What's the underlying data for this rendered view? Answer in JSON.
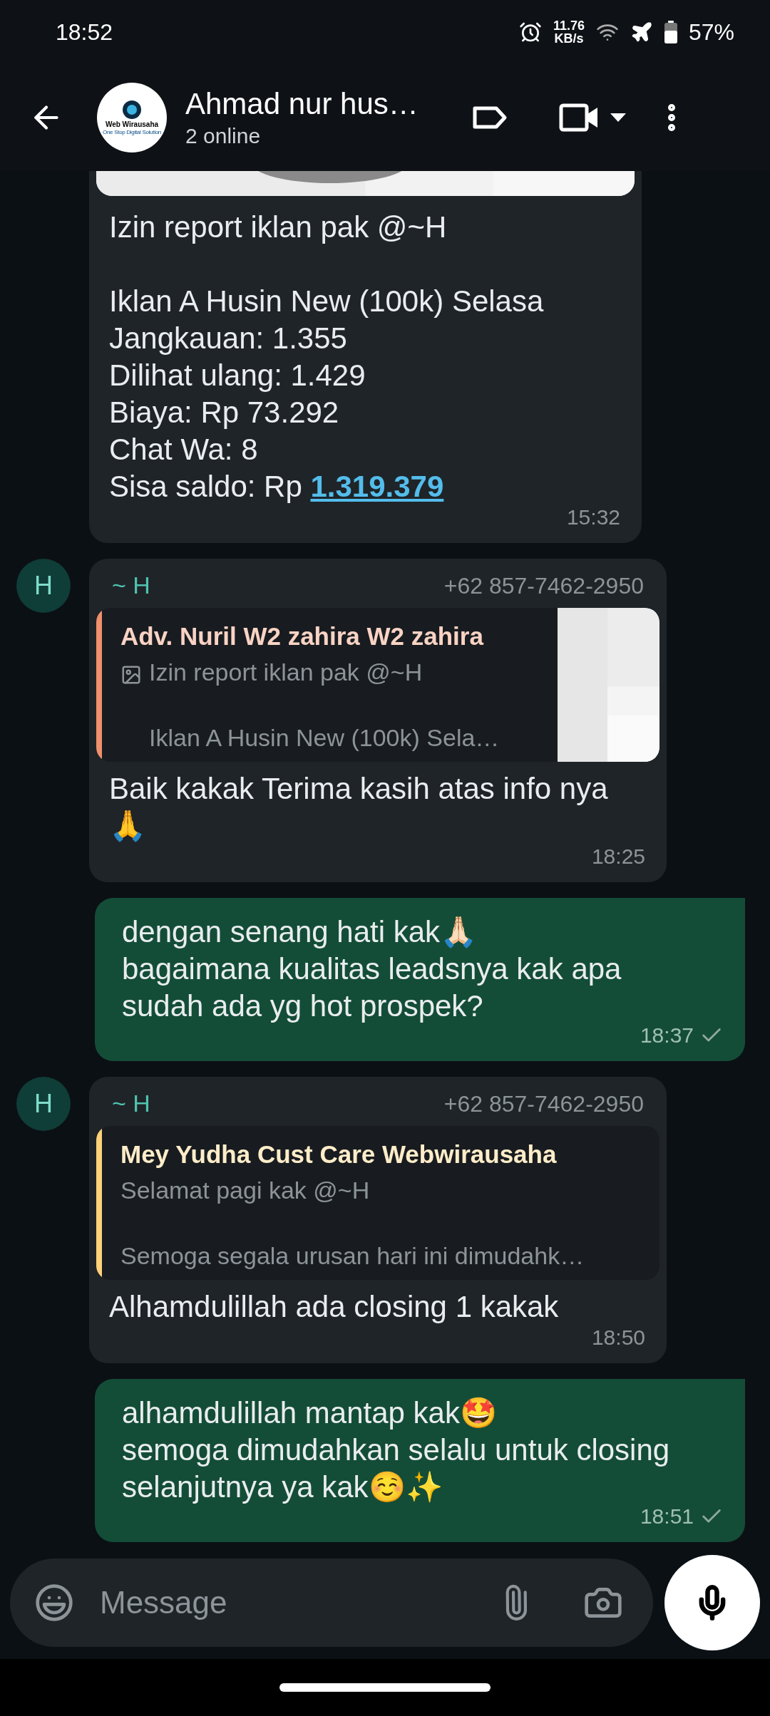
{
  "status_bar": {
    "time": "18:52",
    "net_speed": "11.76",
    "net_unit": "KB/s",
    "battery": "57%"
  },
  "header": {
    "avatar_title": "Web Wirausaha",
    "avatar_tagline": "One Stop Digital Solution",
    "title": "Ahmad nur hus…",
    "subtitle": "2 online"
  },
  "messages": [
    {
      "kind": "incoming",
      "has_picture": true,
      "body": "Izin report iklan pak @~H\n\nIklan A Husin New (100k) Selasa\nJangkauan: 1.355\nDilihat ulang: 1.429\nBiaya: Rp 73.292\nChat Wa: 8\nSisa saldo: Rp ",
      "link": "1.319.379",
      "time": "15:32"
    },
    {
      "kind": "incoming",
      "avatar": "H",
      "sender": "~ H",
      "phone": "+62 857-7462-2950",
      "quote": {
        "name": "Adv. Nuril W2 zahira W2 zahira",
        "color": "#f0906c",
        "has_image": true,
        "text": "Izin report iklan pak @~H\n\nIklan A Husin New (100k) Sela…"
      },
      "body": "Baik kakak Terima kasih atas info nya 🙏",
      "time": "18:25"
    },
    {
      "kind": "outgoing",
      "body": "dengan senang hati kak🙏🏻\nbagaimana kualitas leadsnya kak apa sudah ada yg hot prospek?",
      "time": "18:37",
      "read": false
    },
    {
      "kind": "incoming",
      "avatar": "H",
      "sender": "~ H",
      "phone": "+62 857-7462-2950",
      "quote": {
        "name": "Mey Yudha Cust Care Webwirausaha",
        "color": "#ffd279",
        "has_image": false,
        "text": "Selamat pagi kak @~H\n\nSemoga segala urusan hari ini dimudahk…"
      },
      "body": "Alhamdulillah ada closing 1 kakak",
      "time": "18:50"
    },
    {
      "kind": "outgoing",
      "body": "alhamdulillah mantap kak🤩\nsemoga dimudahkan selalu untuk closing selanjutnya ya kak☺️✨",
      "time": "18:51",
      "read": false
    }
  ],
  "composer": {
    "placeholder": "Message"
  }
}
